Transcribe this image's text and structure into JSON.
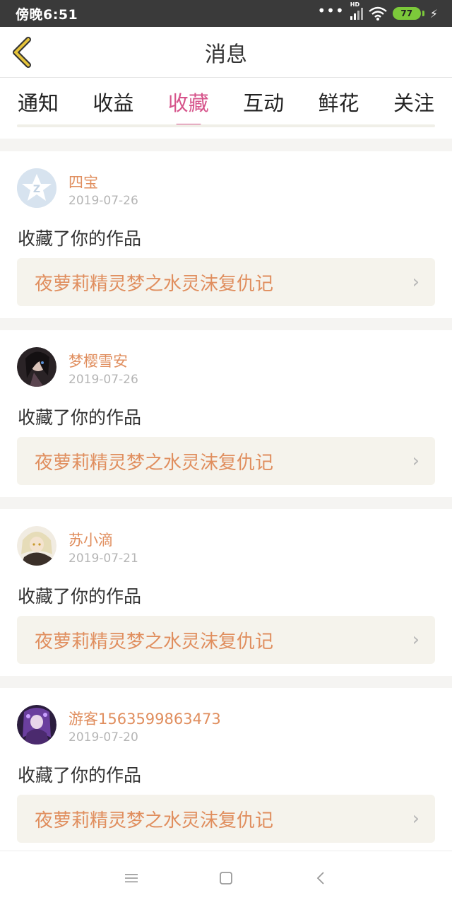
{
  "status_bar": {
    "time": "傍晚6:51",
    "hd": "HD",
    "battery": "77"
  },
  "header": {
    "title": "消息"
  },
  "tabs": [
    {
      "label": "通知",
      "active": false
    },
    {
      "label": "收益",
      "active": false
    },
    {
      "label": "收藏",
      "active": true
    },
    {
      "label": "互动",
      "active": false
    },
    {
      "label": "鲜花",
      "active": false
    },
    {
      "label": "关注",
      "active": false
    }
  ],
  "messages": [
    {
      "user": "四宝",
      "date": "2019-07-26",
      "action": "收藏了你的作品",
      "work": "夜萝莉精灵梦之水灵沫复仇记",
      "avatar": "default-avatar-icon"
    },
    {
      "user": "梦樱雪安",
      "date": "2019-07-26",
      "action": "收藏了你的作品",
      "work": "夜萝莉精灵梦之水灵沫复仇记",
      "avatar": "user-avatar"
    },
    {
      "user": "苏小滴",
      "date": "2019-07-21",
      "action": "收藏了你的作品",
      "work": "夜萝莉精灵梦之水灵沫复仇记",
      "avatar": "user-avatar"
    },
    {
      "user": "游客1563599863473",
      "date": "2019-07-20",
      "action": "收藏了你的作品",
      "work": "夜萝莉精灵梦之水灵沫复仇记",
      "avatar": "user-avatar"
    }
  ],
  "colors": {
    "accent": "#d6548b",
    "username": "#e08e5e",
    "back_arrow": "#e5c33a"
  }
}
